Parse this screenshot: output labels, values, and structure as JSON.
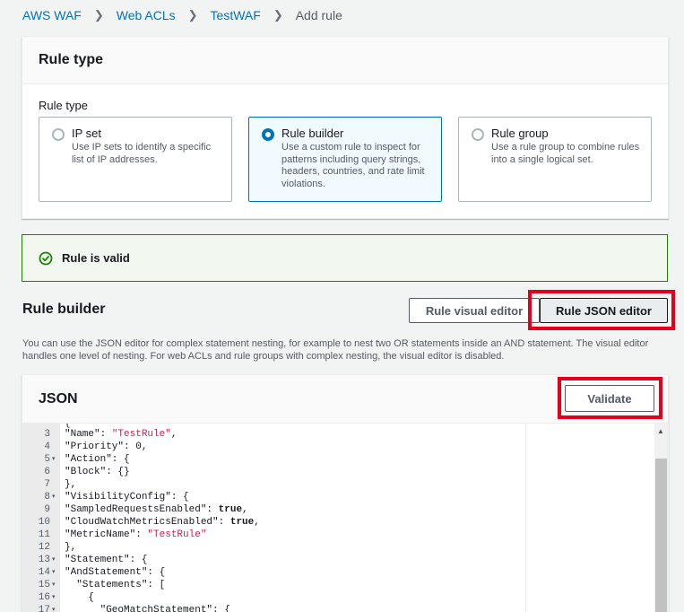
{
  "breadcrumb": {
    "items": [
      "AWS WAF",
      "Web ACLs",
      "TestWAF"
    ],
    "current": "Add rule"
  },
  "rule_type_panel": {
    "title": "Rule type",
    "field_label": "Rule type",
    "options": [
      {
        "title": "IP set",
        "desc": "Use IP sets to identify a specific list of IP addresses.",
        "selected": false
      },
      {
        "title": "Rule builder",
        "desc": "Use a custom rule to inspect for patterns including query strings, headers, countries, and rate limit violations.",
        "selected": true
      },
      {
        "title": "Rule group",
        "desc": "Use a rule group to combine rules into a single logical set.",
        "selected": false
      }
    ]
  },
  "flash": {
    "text": "Rule is valid",
    "color": "#1d8102"
  },
  "rule_builder": {
    "title": "Rule builder",
    "visual_editor_label": "Rule visual editor",
    "json_editor_label": "Rule JSON editor",
    "description": "You can use the JSON editor for complex statement nesting, for example to nest two OR statements inside an AND statement. The visual editor handles one level of nesting. For web ACLs and rule groups with complex nesting, the visual editor is disabled."
  },
  "json_panel": {
    "title": "JSON",
    "validate_label": "Validate",
    "lines": [
      {
        "n": "3",
        "fold": false,
        "indent": "",
        "key": "\"Name\"",
        "sep": ": ",
        "val": "\"TestRule\"",
        "vt": "str",
        "tail": ","
      },
      {
        "n": "4",
        "fold": false,
        "indent": "",
        "key": "\"Priority\"",
        "sep": ": ",
        "val": "0",
        "vt": "num",
        "tail": ","
      },
      {
        "n": "5",
        "fold": true,
        "indent": "",
        "key": "\"Action\"",
        "sep": ": ",
        "val": "{",
        "vt": "plain",
        "tail": ""
      },
      {
        "n": "6",
        "fold": false,
        "indent": "",
        "key": "\"Block\"",
        "sep": ": ",
        "val": "{}",
        "vt": "plain",
        "tail": ""
      },
      {
        "n": "7",
        "fold": false,
        "indent": "",
        "key": "},",
        "sep": "",
        "val": "",
        "vt": "plain",
        "tail": ""
      },
      {
        "n": "8",
        "fold": true,
        "indent": "",
        "key": "\"VisibilityConfig\"",
        "sep": ": ",
        "val": "{",
        "vt": "plain",
        "tail": ""
      },
      {
        "n": "9",
        "fold": false,
        "indent": "",
        "key": "\"SampledRequestsEnabled\"",
        "sep": ": ",
        "val": "true",
        "vt": "kw",
        "tail": ","
      },
      {
        "n": "10",
        "fold": false,
        "indent": "",
        "key": "\"CloudWatchMetricsEnabled\"",
        "sep": ": ",
        "val": "true",
        "vt": "kw",
        "tail": ","
      },
      {
        "n": "11",
        "fold": false,
        "indent": "",
        "key": "\"MetricName\"",
        "sep": ": ",
        "val": "\"TestRule\"",
        "vt": "str",
        "tail": ""
      },
      {
        "n": "12",
        "fold": false,
        "indent": "",
        "key": "},",
        "sep": "",
        "val": "",
        "vt": "plain",
        "tail": ""
      },
      {
        "n": "13",
        "fold": true,
        "indent": "",
        "key": "\"Statement\"",
        "sep": ": ",
        "val": "{",
        "vt": "plain",
        "tail": ""
      },
      {
        "n": "14",
        "fold": true,
        "indent": "",
        "key": "\"AndStatement\"",
        "sep": ": ",
        "val": "{",
        "vt": "plain",
        "tail": ""
      },
      {
        "n": "15",
        "fold": true,
        "indent": "  ",
        "key": "\"Statements\"",
        "sep": ": ",
        "val": "[",
        "vt": "plain",
        "tail": ""
      },
      {
        "n": "16",
        "fold": true,
        "indent": "    ",
        "key": "{",
        "sep": "",
        "val": "",
        "vt": "plain",
        "tail": ""
      },
      {
        "n": "17",
        "fold": true,
        "indent": "      ",
        "key": "\"GeoMatchStatement\"",
        "sep": ": ",
        "val": "{",
        "vt": "plain",
        "tail": ""
      }
    ]
  }
}
